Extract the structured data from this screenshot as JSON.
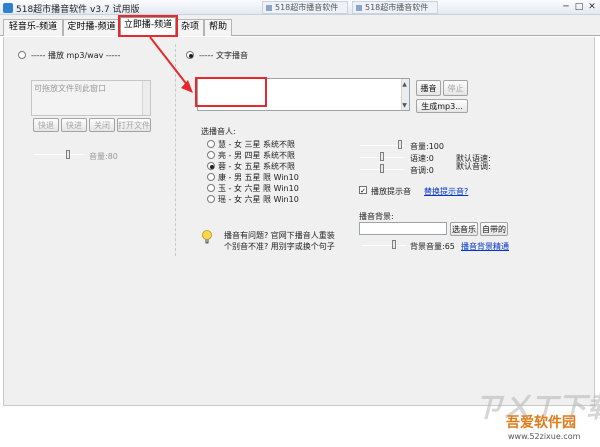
{
  "window": {
    "title": "518超市播音软件 v3.7 试用版",
    "taskbar_items": [
      "518超市播音软件",
      "518超市播音软件"
    ],
    "controls": {
      "minimize": "─",
      "maximize": "□",
      "close": "✕"
    }
  },
  "tabs": [
    {
      "label": "轻音乐-频道"
    },
    {
      "label": "定时播-频道"
    },
    {
      "label": "立即播-频道"
    },
    {
      "label": "杂项"
    },
    {
      "label": "帮助"
    }
  ],
  "left": {
    "mode_label": "----- 播放 mp3/wav -----",
    "drop_hint": "可拖放文件到此窗口",
    "buttons": {
      "prev": "快退",
      "next": "快进",
      "close": "关闭",
      "open": "打开文件"
    },
    "volume_label": "音量:80"
  },
  "right": {
    "mode_label": "----- 文字播音",
    "text_input": "",
    "play_button": "播音",
    "stop_button": "停止",
    "gen_mp3_button": "生成mp3...",
    "voice_header": "选播音人:",
    "voices": [
      {
        "text": "慧 - 女  三星  系统不限",
        "checked": false
      },
      {
        "text": "亮 - 男  四星  系统不限",
        "checked": false
      },
      {
        "text": "蓉 - 女  五星  系统不限",
        "checked": true
      },
      {
        "text": "康 - 男  五星  限 Win10",
        "checked": false
      },
      {
        "text": "玉 - 女  六星  限 Win10",
        "checked": false
      },
      {
        "text": "瑶 - 女  六星  限 Win10",
        "checked": false
      }
    ],
    "volume_label": "音量:100",
    "rate_label": "语速:0",
    "pitch_label": "音调:0",
    "default_rate": "默认语速:",
    "default_pitch": "默认音调:",
    "prompt_checkbox": "播放提示音",
    "prompt_checked": true,
    "change_prompt_link": "替换提示音?",
    "bg_header": "播音背景:",
    "bg_input": "",
    "select_music_button": "选音乐",
    "builtin_button": "自带的",
    "bg_volume_label": "背景音量:65",
    "bg_help_link": "播音背景精通",
    "help_text_1": "播音有问题? 官网下播音人重装",
    "help_text_2": "个别音不准? 用别字或换个句子"
  },
  "watermark": {
    "big": "ㄗㄨㄒ下载",
    "brand": "吾爱软件园",
    "url": "www.52zixue.com"
  },
  "colors": {
    "highlight": "#e8292c",
    "link": "#0033cc",
    "arrow": "#e8292c"
  }
}
